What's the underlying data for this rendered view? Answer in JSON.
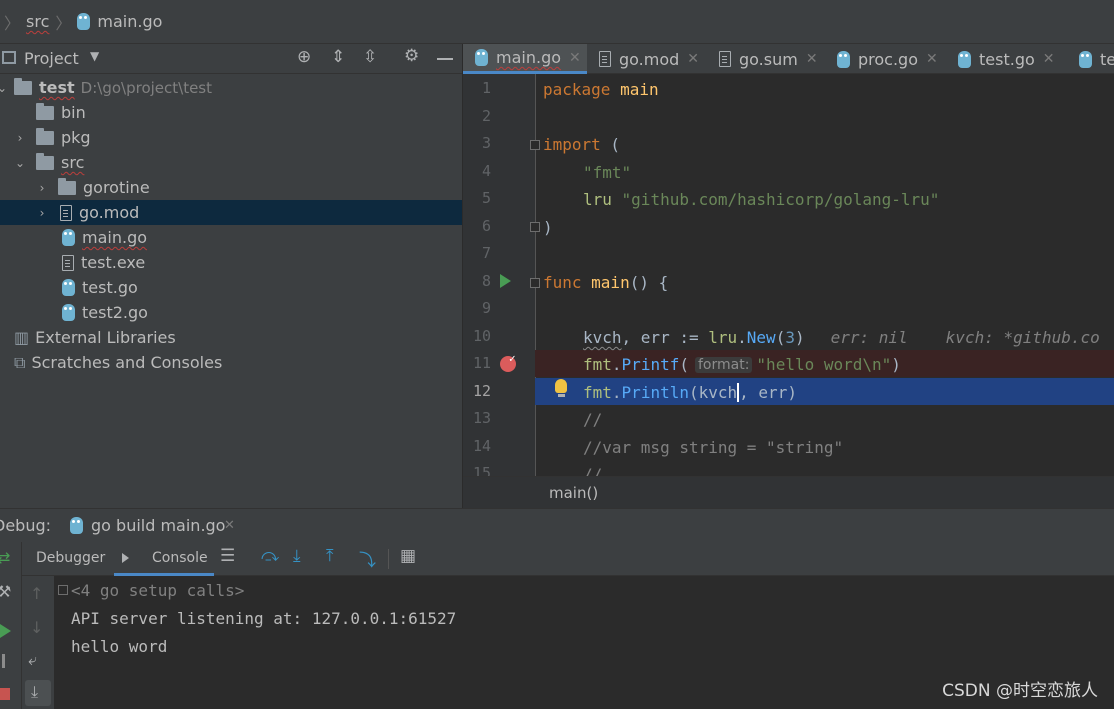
{
  "breadcrumb": {
    "folder": "src",
    "file": "main.go"
  },
  "project_panel": {
    "title": "Project",
    "tree": [
      {
        "label": "test",
        "path": "D:\\go\\project\\test",
        "type": "folder",
        "expanded": true
      },
      {
        "label": "bin",
        "type": "folder"
      },
      {
        "label": "pkg",
        "type": "folder",
        "collapsed": true
      },
      {
        "label": "src",
        "type": "folder",
        "expanded": true
      },
      {
        "label": "gorotine",
        "type": "folder",
        "collapsed": true
      },
      {
        "label": "go.mod",
        "type": "file",
        "selected": true,
        "collapsed": true
      },
      {
        "label": "main.go",
        "type": "go"
      },
      {
        "label": "test.exe",
        "type": "exe"
      },
      {
        "label": "test.go",
        "type": "go"
      },
      {
        "label": "test2.go",
        "type": "go"
      },
      {
        "label": "External Libraries",
        "type": "lib"
      },
      {
        "label": "Scratches and Consoles",
        "type": "scratch"
      }
    ]
  },
  "editor_tabs": [
    {
      "label": "main.go",
      "active": true
    },
    {
      "label": "go.mod"
    },
    {
      "label": "go.sum"
    },
    {
      "label": "proc.go"
    },
    {
      "label": "test.go"
    },
    {
      "label": "tes"
    }
  ],
  "code": {
    "line_numbers": [
      "1",
      "2",
      "3",
      "4",
      "5",
      "6",
      "7",
      "8",
      "9",
      "10",
      "11",
      "12",
      "13",
      "14",
      "15"
    ],
    "l1": {
      "kw": "package",
      "name": " main"
    },
    "l3": {
      "kw": "import",
      "paren": " ("
    },
    "l4": {
      "str": "\"fmt\""
    },
    "l5": {
      "alias": "lru",
      "str": " \"github.com/hashicorp/golang-lru\""
    },
    "l6": {
      "paren": ")"
    },
    "l8": {
      "kw": "func",
      "fn": " main",
      "rest": "() {"
    },
    "l10": {
      "v1": "kvch",
      "rest1": ", err := ",
      "pkg": "lru",
      "dot": ".",
      "fn": "New",
      "p1": "(",
      "num": "3",
      "p2": ")",
      "hint1": "err: nil",
      "hint2": "kvch: *github.co"
    },
    "l11": {
      "pkg": "fmt",
      "dot": ".",
      "fn": "Printf",
      "p1": "(",
      "inlay": "format:",
      "str": "\"hello word\\n\"",
      "p2": ")"
    },
    "l12": {
      "pkg": "fmt",
      "dot": ".",
      "fn": "Println",
      "p1": "(",
      "arg1": "kvch",
      "rest": ", err)"
    },
    "l13": {
      "cm": "//"
    },
    "l14": {
      "cm": "//var msg string = \"string\""
    },
    "l15": {
      "cm": "//"
    }
  },
  "editor_breadcrumb": "main()",
  "debug": {
    "label": "Debug:",
    "config": "go build main.go",
    "tabs": {
      "debugger": "Debugger",
      "console": "Console"
    },
    "console_lines": [
      "<4 go setup calls>",
      "API server listening at: 127.0.0.1:61527",
      "hello word"
    ]
  },
  "watermark": "CSDN @时空恋旅人",
  "colors": {
    "selection": "#214283",
    "breakpoint_line": "#3a2323",
    "accent": "#4a88c7"
  }
}
